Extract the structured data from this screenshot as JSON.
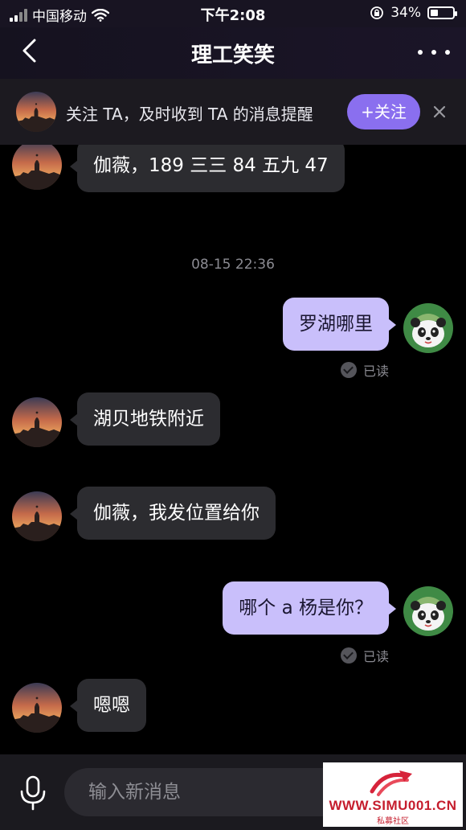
{
  "status_bar": {
    "carrier": "中国移动",
    "time": "下午2:08",
    "battery": "34%",
    "battery_level": 0.34
  },
  "nav": {
    "title": "理工笑笑",
    "back_icon": "chevron-left-icon",
    "more_icon": "more-dots-icon"
  },
  "follow_banner": {
    "text": "关注 TA，及时收到 TA 的消息提醒",
    "button_label": "+关注",
    "close_icon": "close-icon"
  },
  "messages": [
    {
      "side": "in",
      "text": "伽薇，189 三三 84 五九 47"
    },
    {
      "type": "timestamp",
      "text": "08-15  22:36"
    },
    {
      "side": "out",
      "text": "罗湖哪里",
      "status": "已读"
    },
    {
      "side": "in",
      "text": "湖贝地铁附近"
    },
    {
      "side": "in",
      "text": "伽薇，我发位置给你"
    },
    {
      "side": "out",
      "text": "哪个 a 杨是你？",
      "status": "已读"
    },
    {
      "side": "in",
      "text": "嗯嗯"
    }
  ],
  "input_bar": {
    "placeholder": "输入新消息",
    "mic_icon": "microphone-icon"
  },
  "watermark": {
    "url": "WWW.SIMU001.CN",
    "sub": "私募社区"
  },
  "colors": {
    "accent": "#8a6fef",
    "outgoing_bubble": "#c9bffb",
    "incoming_bubble": "#2c2c30",
    "background": "#000000"
  }
}
